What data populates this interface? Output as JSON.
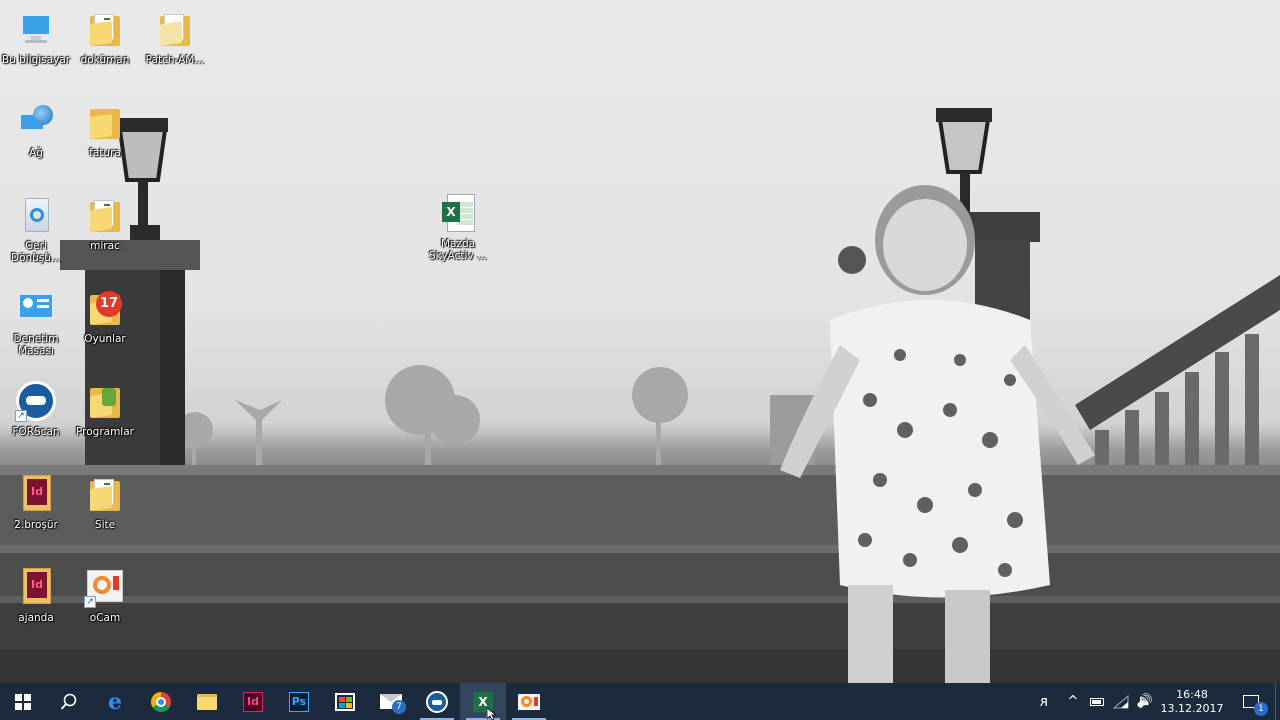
{
  "desktop": {
    "icons": [
      {
        "label": "Bu bilgisayar",
        "icon": "computer-icon"
      },
      {
        "label": "doküman",
        "icon": "folder-icon"
      },
      {
        "label": "Patch-AM...",
        "icon": "folder-icon"
      },
      {
        "label": "Ağ",
        "icon": "network-icon"
      },
      {
        "label": "fatura",
        "icon": "folder-icon"
      },
      {
        "label": "Geri Dönüşü...",
        "icon": "recycle-bin-icon"
      },
      {
        "label": "mirac",
        "icon": "folder-icon"
      },
      {
        "label": "Denetim Masası",
        "icon": "control-panel-icon"
      },
      {
        "label": "Oyunlar",
        "icon": "games-folder-icon"
      },
      {
        "label": "FORScan",
        "icon": "forscan-icon"
      },
      {
        "label": "Programlar",
        "icon": "programs-folder-icon"
      },
      {
        "label": "2.broşür",
        "icon": "indesign-file-icon"
      },
      {
        "label": "Site",
        "icon": "folder-icon"
      },
      {
        "label": "ajanda",
        "icon": "indesign-file-icon"
      },
      {
        "label": "oCam",
        "icon": "ocam-icon"
      },
      {
        "label": "Mazda SkyActiv ...",
        "icon": "excel-file-icon"
      }
    ]
  },
  "taskbar": {
    "buttons": [
      {
        "name": "start",
        "icon": "windows-start-icon"
      },
      {
        "name": "search",
        "icon": "search-icon"
      },
      {
        "name": "edge",
        "icon": "edge-icon"
      },
      {
        "name": "chrome",
        "icon": "chrome-icon"
      },
      {
        "name": "file-explorer",
        "icon": "folder-icon"
      },
      {
        "name": "indesign",
        "icon": "indesign-icon"
      },
      {
        "name": "photoshop",
        "icon": "photoshop-icon"
      },
      {
        "name": "store",
        "icon": "store-icon"
      },
      {
        "name": "mail",
        "icon": "mail-icon",
        "badge": "7"
      },
      {
        "name": "forscan",
        "icon": "forscan-icon"
      },
      {
        "name": "excel",
        "icon": "excel-icon"
      },
      {
        "name": "ocam",
        "icon": "ocam-icon"
      }
    ],
    "tray": {
      "people_glyph": "ᴙ",
      "chevron_glyph": "^",
      "speaker_glyph": "🔊",
      "time": "16:48",
      "date": "13.12.2017",
      "notification_count": "1"
    }
  },
  "colors": {
    "taskbar_bg": "#1b2a3d",
    "accent": "#8ab4e8",
    "excel_green": "#1e7145",
    "indesign_pink": "#e0245e",
    "photoshop_blue": "#31a8ff"
  }
}
